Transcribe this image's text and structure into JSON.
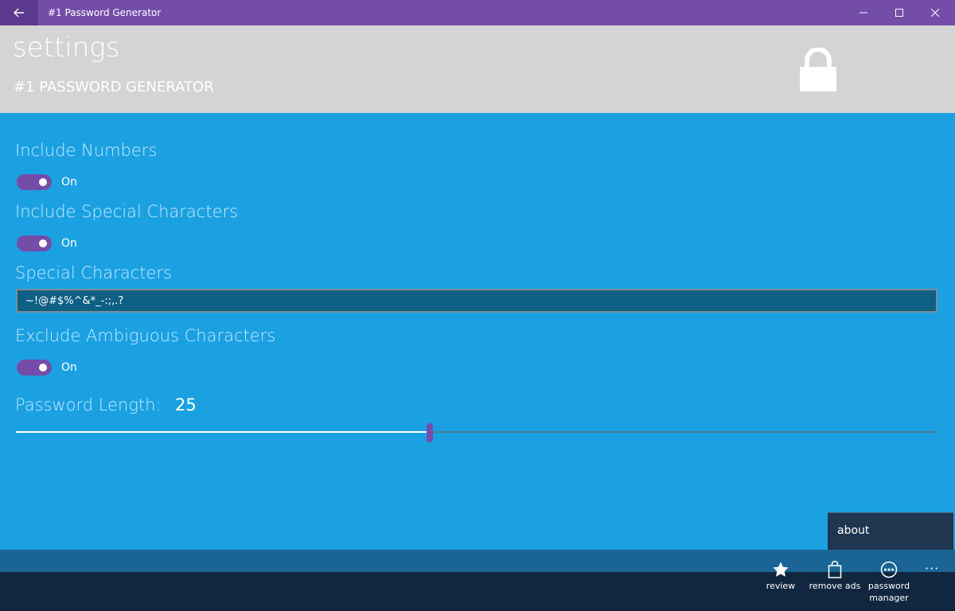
{
  "window": {
    "title": "#1 Password Generator"
  },
  "header": {
    "title": "settings",
    "subtitle": "#1 PASSWORD GENERATOR"
  },
  "settings": {
    "include_numbers": {
      "label": "Include Numbers",
      "state": "On"
    },
    "include_special": {
      "label": "Include Special Characters",
      "state": "On"
    },
    "special_characters": {
      "label": "Special Characters",
      "value": "~!@#$%^&*_-:;,.?"
    },
    "exclude_ambiguous": {
      "label": "Exclude Ambiguous Characters",
      "state": "On"
    },
    "password_length": {
      "label": "Password Length:",
      "value": "25",
      "fraction": 0.445
    }
  },
  "menu": {
    "about": "about"
  },
  "appbar": {
    "review": "review",
    "remove_ads": "remove ads",
    "password_manager_line1": "password",
    "password_manager_line2": "manager",
    "more": "···"
  },
  "colors": {
    "titlebar": "#744da9",
    "header": "#d4d4d4",
    "content": "#1ba1e2",
    "accent": "#744da9",
    "appbar": "#10273f"
  }
}
